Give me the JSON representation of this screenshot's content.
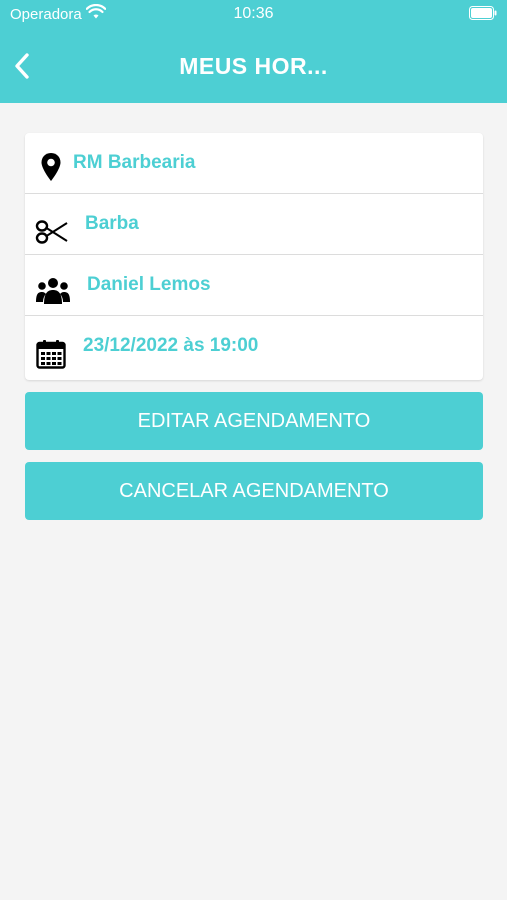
{
  "status_bar": {
    "carrier": "Operadora",
    "time": "10:36"
  },
  "header": {
    "title": "MEUS HOR...",
    "back_icon": "chevron-left-icon",
    "color": "#4dcfd3"
  },
  "appointment": {
    "place": {
      "icon": "location-pin-icon",
      "label": "RM Barbearia"
    },
    "service": {
      "icon": "scissors-icon",
      "label": "Barba"
    },
    "professional": {
      "icon": "users-icon",
      "label": "Daniel Lemos"
    },
    "datetime": {
      "icon": "calendar-icon",
      "label": "23/12/2022 às 19:00"
    }
  },
  "actions": {
    "edit_label": "EDITAR AGENDAMENTO",
    "cancel_label": "CANCELAR AGENDAMENTO"
  }
}
